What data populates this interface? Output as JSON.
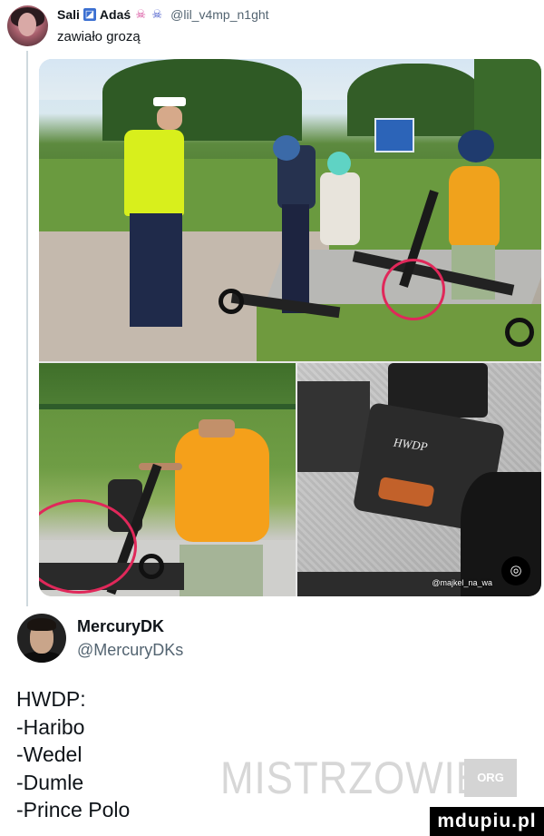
{
  "tweet": {
    "author_name": "Sali",
    "author_handle": "@lil_v4mp_n1ght",
    "author_name_extra": "Adaś",
    "icons": [
      "flag-icon",
      "octopus-icon",
      "octopus-icon"
    ],
    "text": "zawiało grozą",
    "media": {
      "watermark": "@majkel_na_wa",
      "badge_icon": "instagram-icon",
      "frame_plate_text": "HWDP"
    }
  },
  "reply": {
    "author_name": "MercuryDK",
    "author_handle": "@MercuryDKs",
    "lines": [
      "HWDP:",
      "-Haribo",
      "-Wedel",
      "-Dumle",
      "-Prince Polo"
    ]
  },
  "watermarks": {
    "site": "MISTRZOWIE",
    "site_badge": "ORG",
    "corner": "mdupiu.pl"
  },
  "colors": {
    "text": "#0f1419",
    "secondary": "#536471",
    "highlight_circle": "#e0285a"
  }
}
